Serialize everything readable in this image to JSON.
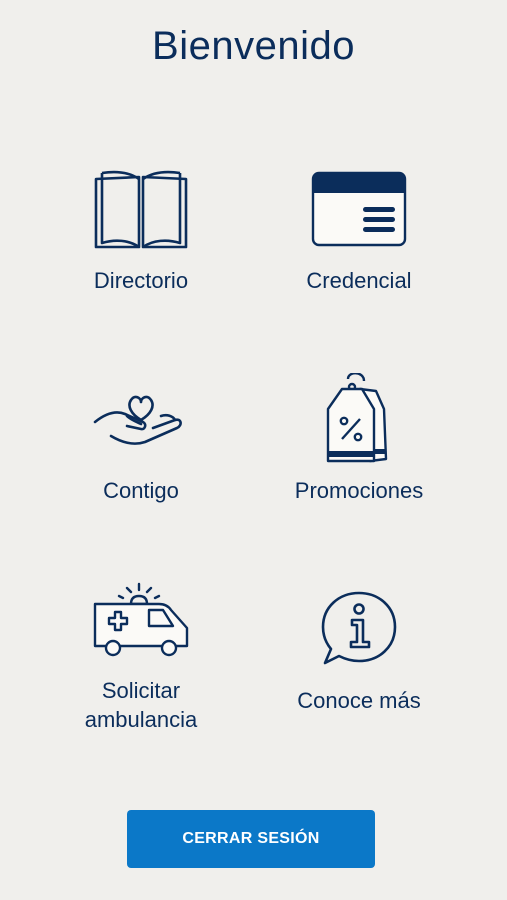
{
  "header": {
    "title": "Bienvenido"
  },
  "menu": [
    {
      "id": "directorio",
      "label": "Directorio",
      "icon": "open-book-icon"
    },
    {
      "id": "credencial",
      "label": "Credencial",
      "icon": "id-card-icon"
    },
    {
      "id": "contigo",
      "label": "Contigo",
      "icon": "hand-heart-icon"
    },
    {
      "id": "promociones",
      "label": "Promociones",
      "icon": "price-tag-percent-icon"
    },
    {
      "id": "ambulancia",
      "label_line1": "Solicitar",
      "label_line2": "ambulancia",
      "icon": "ambulance-icon"
    },
    {
      "id": "conoce",
      "label": "Conoce más",
      "icon": "info-bubble-icon"
    }
  ],
  "footer": {
    "logout_label": "CERRAR SESIÓN"
  },
  "colors": {
    "background": "#f0efec",
    "primary_text": "#0b2d5b",
    "button": "#0b78c8"
  }
}
